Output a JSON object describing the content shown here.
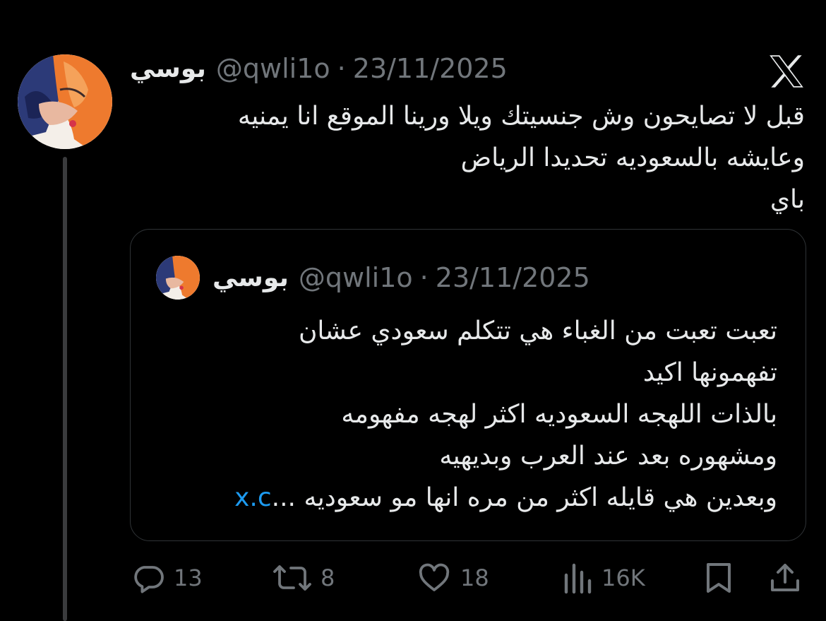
{
  "post": {
    "display_name": "بوسي",
    "handle": "@qwli1o",
    "separator": "·",
    "date": "23/11/2025",
    "lines": [
      "قبل لا تصايحون وش جنسيتك ويلا ورينا الموقع انا يمنيه",
      "وعايشه بالسعوديه تحديدا الرياض",
      "باي"
    ]
  },
  "quote": {
    "display_name": "بوسي",
    "handle": "@qwli1o",
    "separator": "·",
    "date": "23/11/2025",
    "lines": [
      "تعبت تعبت من الغباء هي تتكلم سعودي عشان",
      "تفهمونها اكيد",
      "بالذات اللهجه السعوديه اكثر لهجه مفهومه",
      "ومشهوره بعد عند العرب وبديهيه"
    ],
    "last_line_text": "وبعدين هي قايله اكثر من مره انها مو سعوديه ...",
    "link_text": "x.c"
  },
  "actions": {
    "replies": "13",
    "reposts": "8",
    "likes": "18",
    "views": "16K"
  },
  "icons": {
    "brand": "x-logo-icon",
    "reply": "reply-icon",
    "repost": "repost-icon",
    "like": "heart-icon",
    "views": "views-icon",
    "bookmark": "bookmark-icon",
    "share": "share-icon"
  },
  "colors": {
    "background": "#000000",
    "text": "#e7e9ea",
    "muted": "#71767b",
    "link": "#1d9bf0",
    "border": "#2f3336"
  }
}
